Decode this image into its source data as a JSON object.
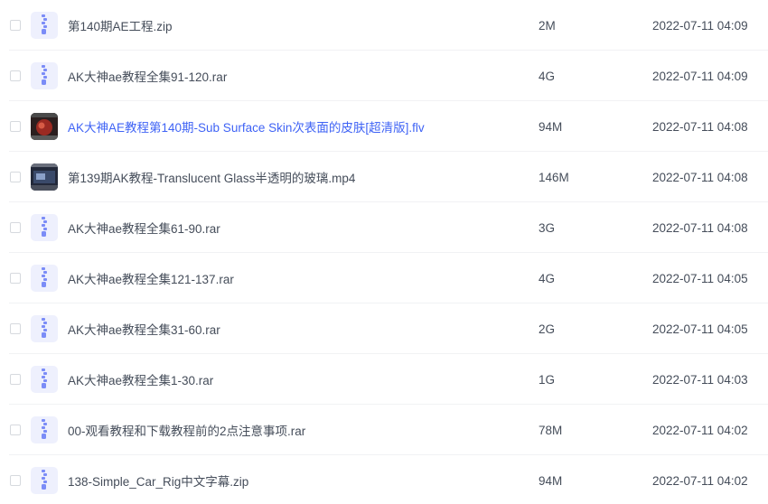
{
  "files": [
    {
      "name": "第140期AE工程.zip",
      "size": "2M",
      "modified": "2022-07-11 04:09",
      "icon": "archive-icon"
    },
    {
      "name": "AK大神ae教程全集91-120.rar",
      "size": "4G",
      "modified": "2022-07-11 04:09",
      "icon": "archive-icon"
    },
    {
      "name": "AK大神AE教程第140期-Sub Surface Skin次表面的皮肤[超清版].flv",
      "size": "94M",
      "modified": "2022-07-11 04:08",
      "icon": "video-thumbnail-icon",
      "highlight_color": "#3f63f5"
    },
    {
      "name": "第139期AK教程-Translucent Glass半透明的玻璃.mp4",
      "size": "146M",
      "modified": "2022-07-11 04:08",
      "icon": "video-thumbnail-icon"
    },
    {
      "name": "AK大神ae教程全集61-90.rar",
      "size": "3G",
      "modified": "2022-07-11 04:08",
      "icon": "archive-icon"
    },
    {
      "name": "AK大神ae教程全集121-137.rar",
      "size": "4G",
      "modified": "2022-07-11 04:05",
      "icon": "archive-icon"
    },
    {
      "name": "AK大神ae教程全集31-60.rar",
      "size": "2G",
      "modified": "2022-07-11 04:05",
      "icon": "archive-icon"
    },
    {
      "name": "AK大神ae教程全集1-30.rar",
      "size": "1G",
      "modified": "2022-07-11 04:03",
      "icon": "archive-icon"
    },
    {
      "name": "00-观看教程和下载教程前的2点注意事项.rar",
      "size": "78M",
      "modified": "2022-07-11 04:02",
      "icon": "archive-icon"
    },
    {
      "name": "138-Simple_Car_Rig中文字幕.zip",
      "size": "94M",
      "modified": "2022-07-11 04:02",
      "icon": "archive-icon"
    }
  ],
  "colors": {
    "text": "#454d5a",
    "accent": "#3f63f5",
    "archive_icon_bg": "#eef0fd",
    "archive_icon_fg": "#7b8cf7",
    "divider": "#f1f2f4"
  }
}
